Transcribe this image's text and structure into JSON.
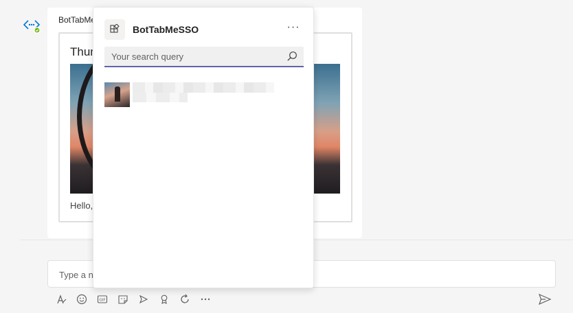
{
  "chat": {
    "sender": "BotTabMeSSO",
    "card_title": "Thumbnail",
    "card_text": "Hello, "
  },
  "compose": {
    "placeholder": "Type a new message"
  },
  "toolbar": {
    "icons": [
      "format-icon",
      "emoji-icon",
      "gif-icon",
      "sticker-icon",
      "meet-now-icon",
      "praise-icon",
      "loop-icon",
      "more-options-icon",
      "send-icon"
    ]
  },
  "popup": {
    "app_name": "BotTabMeSSO",
    "more": "···",
    "search_placeholder": "Your search query",
    "search_value": ""
  },
  "colors": {
    "accent": "#6264a7",
    "background": "#f5f5f5",
    "surface": "#ffffff"
  }
}
